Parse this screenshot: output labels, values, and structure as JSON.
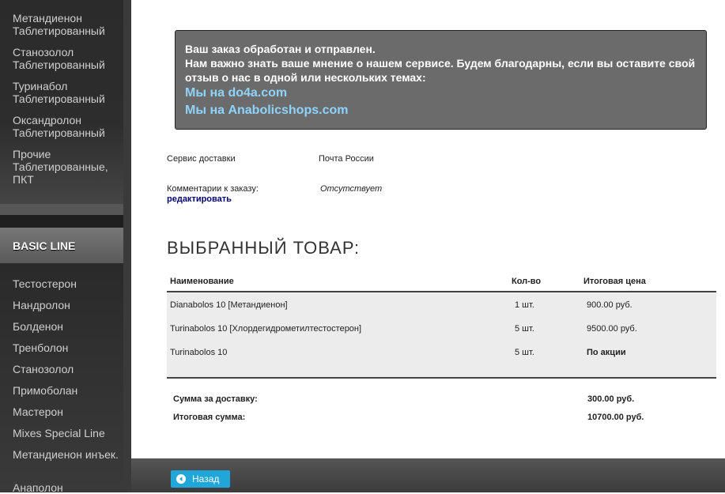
{
  "sidebar": {
    "top_items": [
      {
        "label": "Метандиенон Таблетированный"
      },
      {
        "label": "Станозолол Таблетированный"
      },
      {
        "label": "Туринабол Таблетированный"
      },
      {
        "label": "Оксандролон Таблетированный"
      },
      {
        "label": "Прочие Таблетированные, ПКТ"
      }
    ],
    "section_title": "BASIC LINE",
    "bottom_items": [
      {
        "label": "Тестостерон"
      },
      {
        "label": "Нандролон"
      },
      {
        "label": "Болденон"
      },
      {
        "label": "Тренболон"
      },
      {
        "label": "Станозолол"
      },
      {
        "label": "Примоболан"
      },
      {
        "label": "Мастерон"
      },
      {
        "label": "Mixes Special Line"
      },
      {
        "label": "Метандиенон инъек."
      },
      {
        "label": "Анаполон"
      }
    ]
  },
  "notice": {
    "line1": "Ваш заказ обработан и отправлен.",
    "line2": "Нам важно знать ваше мнение о нашем сервисе. Будем благодарны, если вы оставите свой отзыв о нас в одной или нескольких темах:",
    "link1": "Мы на do4a.com",
    "link2": "Мы на Anabolicshops.com"
  },
  "order": {
    "delivery_label": "Сервис доставки",
    "delivery_value": "Почта России",
    "comment_label": "Комментарии к заказу:",
    "comment_value": "Отсутствует",
    "edit_link": "редактировать"
  },
  "products": {
    "title": "ВЫБРАННЫЙ ТОВАР:",
    "headers": {
      "name": "Наименование",
      "qty": "Кол-во",
      "total": "Итоговая цена"
    },
    "rows": [
      {
        "name": "Dianabolos 10 [Метандиенон]",
        "qty": "1 шт.",
        "price": "900.00 руб."
      },
      {
        "name": "Turinabolos 10 [Хлордегидрометилтестостерон]",
        "qty": "5 шт.",
        "price": "9500.00 руб."
      },
      {
        "name": "Turinabolos 10",
        "qty": "5 шт.",
        "price": "По акции"
      }
    ],
    "delivery_sum_label": "Сумма за доставку:",
    "delivery_sum_value": "300.00 руб.",
    "total_label": "Итоговая сумма:",
    "total_value": "10700.00 руб."
  },
  "footer": {
    "back_label": "Назад",
    "back_icon": "arrow-left-circle-icon"
  },
  "colors": {
    "accent": "#20a6d8",
    "link": "#8fd3ff",
    "edit_link": "#00007a"
  }
}
